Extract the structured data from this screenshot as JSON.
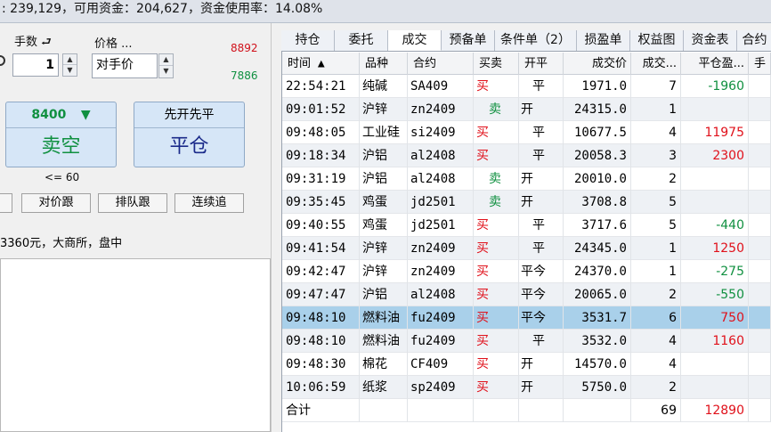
{
  "status_bar": {
    "text": ": 239,129，可用资金：204,627，资金使用率：14.08%"
  },
  "order_panel": {
    "qty_label": "手数",
    "qty_value": "1",
    "price_label": "价格 ...",
    "price_value": "对手价",
    "price_up": "8892",
    "price_down": "7886",
    "sell_price": "8400",
    "sell_label": "卖空",
    "close_header": "先开先平",
    "close_label": "平仓",
    "limit_note": "<= 60",
    "btn_counter": "对价跟",
    "btn_queue": "排队跟",
    "btn_chase": "连续追",
    "info_text": "3360元，大商所，盘中"
  },
  "tabs": [
    "持仓",
    "委托",
    "成交",
    "预备单",
    "条件单（2）",
    "损盈单",
    "权益图",
    "资金表",
    "合约"
  ],
  "active_tab": 2,
  "table": {
    "headers": [
      "时间 ▲",
      "品种",
      "合约",
      "买卖",
      "开平",
      "成交价",
      "成交...",
      "平仓盈...",
      "手"
    ],
    "rows": [
      {
        "time": "22:54:21",
        "variety": "纯碱",
        "contract": "SA409",
        "side": "买",
        "oc": "平",
        "price": "1971.0",
        "qty": "7",
        "pnl": "-1960"
      },
      {
        "time": "09:01:52",
        "variety": "沪锌",
        "contract": "zn2409",
        "side": "卖",
        "oc": "开",
        "price": "24315.0",
        "qty": "1",
        "pnl": ""
      },
      {
        "time": "09:48:05",
        "variety": "工业硅",
        "contract": "si2409",
        "side": "买",
        "oc": "平",
        "price": "10677.5",
        "qty": "4",
        "pnl": "11975"
      },
      {
        "time": "09:18:34",
        "variety": "沪铝",
        "contract": "al2408",
        "side": "买",
        "oc": "平",
        "price": "20058.3",
        "qty": "3",
        "pnl": "2300"
      },
      {
        "time": "09:31:19",
        "variety": "沪铝",
        "contract": "al2408",
        "side": "卖",
        "oc": "开",
        "price": "20010.0",
        "qty": "2",
        "pnl": ""
      },
      {
        "time": "09:35:45",
        "variety": "鸡蛋",
        "contract": "jd2501",
        "side": "卖",
        "oc": "开",
        "price": "3708.8",
        "qty": "5",
        "pnl": ""
      },
      {
        "time": "09:40:55",
        "variety": "鸡蛋",
        "contract": "jd2501",
        "side": "买",
        "oc": "平",
        "price": "3717.6",
        "qty": "5",
        "pnl": "-440"
      },
      {
        "time": "09:41:54",
        "variety": "沪锌",
        "contract": "zn2409",
        "side": "买",
        "oc": "平",
        "price": "24345.0",
        "qty": "1",
        "pnl": "1250"
      },
      {
        "time": "09:42:47",
        "variety": "沪锌",
        "contract": "zn2409",
        "side": "买",
        "oc": "平今",
        "price": "24370.0",
        "qty": "1",
        "pnl": "-275"
      },
      {
        "time": "09:47:47",
        "variety": "沪铝",
        "contract": "al2408",
        "side": "买",
        "oc": "平今",
        "price": "20065.0",
        "qty": "2",
        "pnl": "-550"
      },
      {
        "time": "09:48:10",
        "variety": "燃料油",
        "contract": "fu2409",
        "side": "买",
        "oc": "平今",
        "price": "3531.7",
        "qty": "6",
        "pnl": "750"
      },
      {
        "time": "09:48:10",
        "variety": "燃料油",
        "contract": "fu2409",
        "side": "买",
        "oc": "平",
        "price": "3532.0",
        "qty": "4",
        "pnl": "1160"
      },
      {
        "time": "09:48:30",
        "variety": "棉花",
        "contract": "CF409",
        "side": "买",
        "oc": "开",
        "price": "14570.0",
        "qty": "4",
        "pnl": ""
      },
      {
        "time": "10:06:59",
        "variety": "纸浆",
        "contract": "sp2409",
        "side": "买",
        "oc": "开",
        "price": "5750.0",
        "qty": "2",
        "pnl": ""
      }
    ],
    "selected_row": 10,
    "total": {
      "label": "合计",
      "qty": "69",
      "pnl": "12890"
    }
  },
  "colors": {
    "buy": "#e0101a",
    "sell": "#109040",
    "selected_row": "#a9d0ea",
    "alt_row": "#eef1f5"
  }
}
